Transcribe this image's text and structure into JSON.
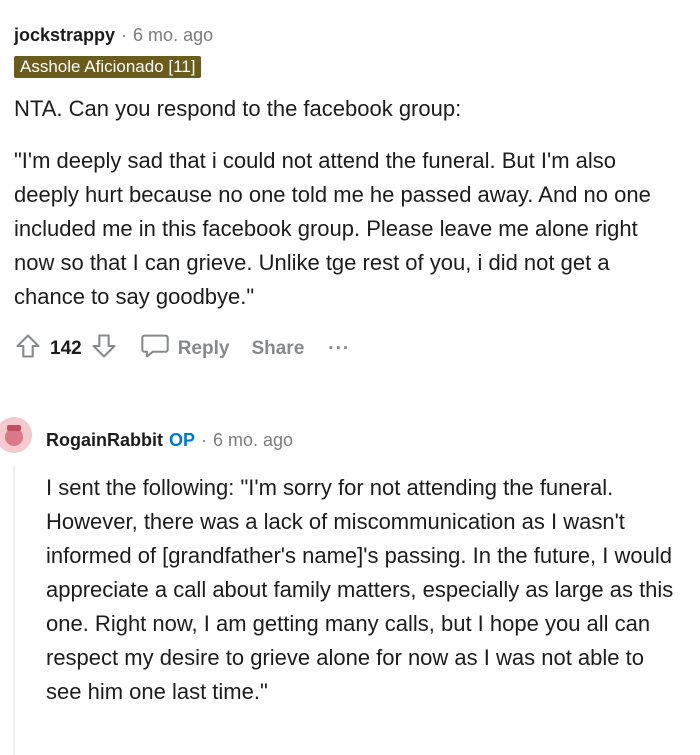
{
  "comment": {
    "author": "jockstrappy",
    "separator": "·",
    "time": "6 mo. ago",
    "flair": "Asshole Aficionado [11]",
    "paragraphs": [
      "NTA. Can you respond to the facebook group:",
      "\"I'm deeply sad that i could not attend the funeral. But I'm also deeply hurt because no one told me he passed away. And no one included me in this facebook group. Please leave me alone right now so that I can grieve. Unlike tge rest of you, i did not get a chance to say goodbye.\""
    ],
    "votes": "142",
    "reply_label": "Reply",
    "share_label": "Share",
    "more_label": "···"
  },
  "reply": {
    "author": "RogainRabbit",
    "op_badge": "OP",
    "separator": "·",
    "time": "6 mo. ago",
    "text": "I sent the following: \"I'm sorry for not attending the funeral. However, there was a lack of miscommunication as I wasn't informed of [grandfather's name]'s passing. In the future, I would appreciate a call about family matters, especially as large as this one. Right now, I am getting many calls, but I hope you all can respect my desire to grieve alone for now as I was not able to see him one last time.\""
  },
  "colors": {
    "flair_bg": "#6b5b1c",
    "op_blue": "#0079d3",
    "muted": "#7c7c7c"
  }
}
